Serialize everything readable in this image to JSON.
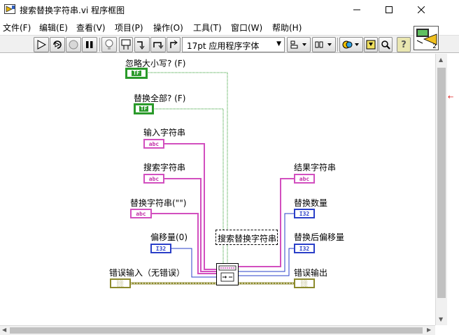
{
  "window": {
    "title": "搜索替换字符串.vi 程序框图"
  },
  "menu": {
    "items": [
      "文件(F)",
      "编辑(E)",
      "查看(V)",
      "项目(P)",
      "操作(O)",
      "工具(T)",
      "窗口(W)",
      "帮助(H)"
    ]
  },
  "toolbar": {
    "font_value": "17pt 应用程序字体",
    "help_label": "?"
  },
  "connector_pane": {
    "number": "2"
  },
  "diagram": {
    "ignore_case_label": "忽略大小写? (F)",
    "replace_all_label": "替换全部? (F)",
    "input_string_label": "输入字符串",
    "search_string_label": "搜索字符串",
    "replace_string_label": "替换字符串(\"\")",
    "offset_label": "偏移量(0)",
    "error_in_label": "错误输入（无错误）",
    "function_label": "搜索替换字符串",
    "result_string_label": "结果字符串",
    "replace_count_label": "替换数量",
    "offset_after_label": "替换后偏移量",
    "error_out_label": "错误输出",
    "bool_glyph": "TF",
    "string_glyph": "abc",
    "i32_glyph": "I32",
    "err_glyph": "░░"
  },
  "colors": {
    "boolean_wire": "#2a9a2a",
    "string_wire": "#d24fbf",
    "numeric_wire": "#2a3fc8",
    "error_wire": "#8c8a2c"
  }
}
